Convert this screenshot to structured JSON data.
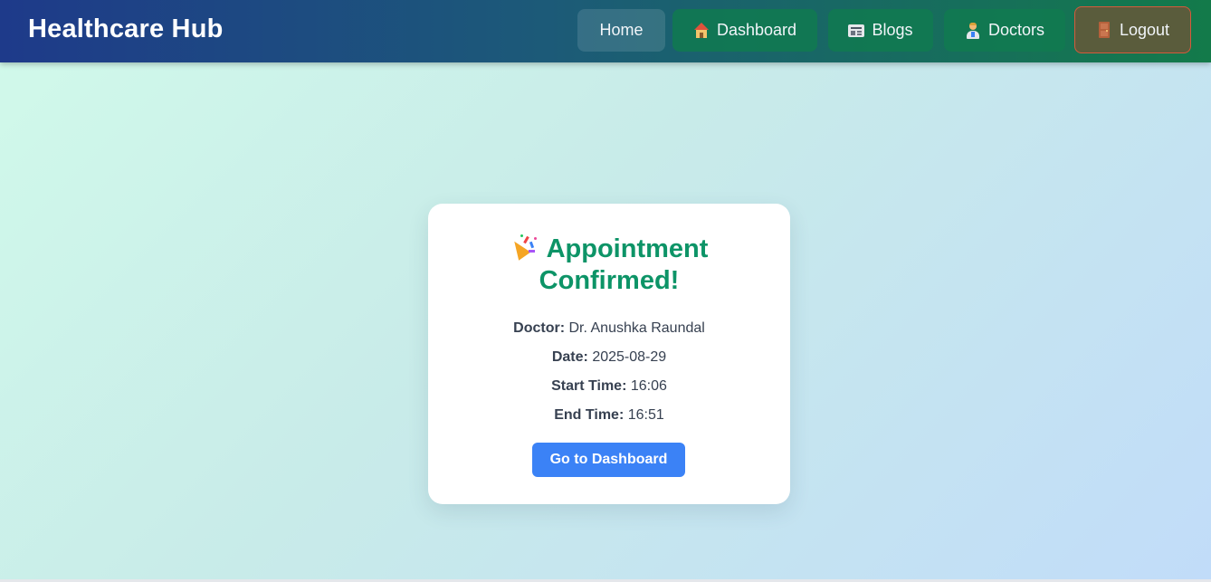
{
  "navbar": {
    "brand": "Healthcare Hub",
    "items": [
      {
        "label": "Home",
        "icon": ""
      },
      {
        "label": "Dashboard",
        "icon": "house-icon"
      },
      {
        "label": "Blogs",
        "icon": "newspaper-icon"
      },
      {
        "label": "Doctors",
        "icon": "doctor-icon"
      },
      {
        "label": "Logout",
        "icon": "door-icon"
      }
    ]
  },
  "confirmation": {
    "icon": "party-popper-icon",
    "title_line1": "Appointment",
    "title_line2": "Confirmed!",
    "doctor_label": "Doctor:",
    "doctor_value": "Dr. Anushka Raundal",
    "date_label": "Date:",
    "date_value": "2025-08-29",
    "start_label": "Start Time:",
    "start_value": "16:06",
    "end_label": "End Time:",
    "end_value": "16:51",
    "button_label": "Go to Dashboard"
  },
  "colors": {
    "title_green": "#0d9467",
    "button_blue": "#3b82f6",
    "nav_start": "#1e3a8a",
    "nav_end": "#137a4a",
    "logout_border": "#d45a3c"
  }
}
